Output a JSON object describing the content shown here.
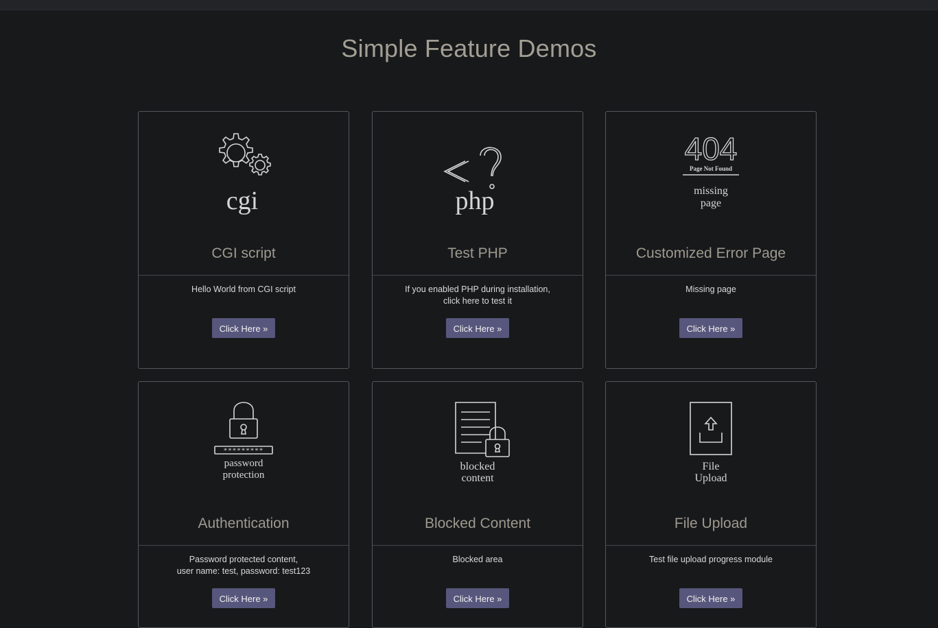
{
  "page": {
    "title": "Simple Feature Demos"
  },
  "cards": [
    {
      "title": "CGI script",
      "icon": "cgi-gears-icon",
      "icon_text": [
        "cgi"
      ],
      "description": [
        "Hello World from CGI script"
      ],
      "button_label": "Click Here »"
    },
    {
      "title": "Test PHP",
      "icon": "php-icon",
      "icon_text": [
        "php"
      ],
      "description": [
        "If you enabled PHP during installation,",
        "click here to test it"
      ],
      "button_label": "Click Here »"
    },
    {
      "title": "Customized Error Page",
      "icon": "404-missing-page-icon",
      "icon_text": [
        "404",
        "Page Not Found",
        "missing",
        "page"
      ],
      "description": [
        "Missing page"
      ],
      "button_label": "Click Here »"
    },
    {
      "title": "Authentication",
      "icon": "padlock-password-icon",
      "icon_text": [
        "password",
        "protection"
      ],
      "description": [
        "Password protected content,",
        "user name: test, password: test123"
      ],
      "button_label": "Click Here »"
    },
    {
      "title": "Blocked Content",
      "icon": "blocked-document-icon",
      "icon_text": [
        "blocked",
        "content"
      ],
      "description": [
        "Blocked area"
      ],
      "button_label": "Click Here »"
    },
    {
      "title": "File Upload",
      "icon": "file-upload-icon",
      "icon_text": [
        "File",
        "Upload"
      ],
      "description": [
        "Test file upload progress module"
      ],
      "button_label": "Click Here »"
    }
  ]
}
